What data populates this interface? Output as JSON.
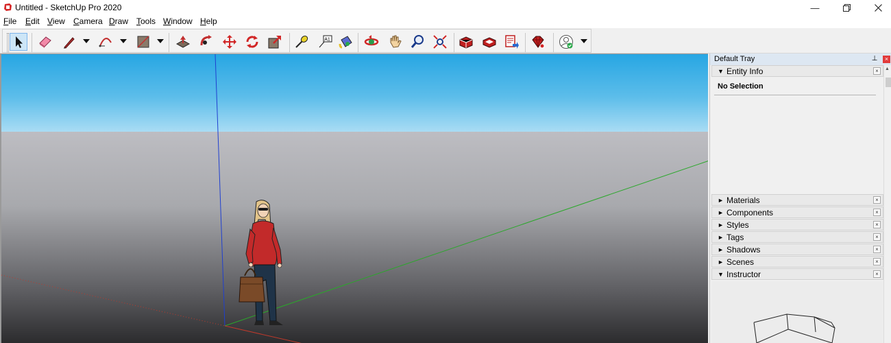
{
  "window": {
    "title": "Untitled - SketchUp Pro 2020",
    "controls": [
      "minimize-icon",
      "restore-icon",
      "close-icon"
    ]
  },
  "menu": [
    {
      "label": "File",
      "mnemonic": "F",
      "rest": "ile"
    },
    {
      "label": "Edit",
      "mnemonic": "E",
      "rest": "dit"
    },
    {
      "label": "View",
      "mnemonic": "V",
      "rest": "iew"
    },
    {
      "label": "Camera",
      "mnemonic": "C",
      "rest": "amera"
    },
    {
      "label": "Draw",
      "mnemonic": "D",
      "rest": "raw"
    },
    {
      "label": "Tools",
      "mnemonic": "T",
      "rest": "ools"
    },
    {
      "label": "Window",
      "mnemonic": "W",
      "rest": "indow"
    },
    {
      "label": "Help",
      "mnemonic": "H",
      "rest": "elp"
    }
  ],
  "toolbar": {
    "tools": [
      "select-tool-icon",
      "eraser-tool-icon",
      "line-tool-icon",
      "arc-tool-icon",
      "shape-tool-icon",
      "push-pull-tool-icon",
      "follow-me-tool-icon",
      "move-tool-icon",
      "rotate-tool-icon",
      "scale-tool-icon",
      "tape-measure-tool-icon",
      "text-tool-icon",
      "paint-bucket-tool-icon",
      "orbit-tool-icon",
      "pan-tool-icon",
      "zoom-tool-icon",
      "zoom-extents-tool-icon",
      "3d-warehouse-icon",
      "extension-warehouse-icon",
      "layout-send-icon",
      "extension-manager-icon",
      "account-icon"
    ],
    "text_tool_label": "A1",
    "active_tool": "select-tool-icon"
  },
  "tray": {
    "title": "Default Tray",
    "entity_info": {
      "label": "Entity Info",
      "expanded": true,
      "content": "No Selection"
    },
    "panels": [
      {
        "label": "Materials",
        "expanded": false
      },
      {
        "label": "Components",
        "expanded": false
      },
      {
        "label": "Styles",
        "expanded": false
      },
      {
        "label": "Tags",
        "expanded": false
      },
      {
        "label": "Shadows",
        "expanded": false
      },
      {
        "label": "Scenes",
        "expanded": false
      },
      {
        "label": "Instructor",
        "expanded": true
      }
    ],
    "collapsed_glyph": "►",
    "expanded_glyph": "▼",
    "close_glyph": "×"
  },
  "colors": {
    "sky_top": "#27a6e3",
    "ground": "#a8a9ad",
    "axis_blue": "#1f3fd0",
    "axis_green": "#2aa82a",
    "axis_red": "#c0392b",
    "tray_header": "#dde7f2",
    "active_tool_bg": "#cde6f7"
  }
}
